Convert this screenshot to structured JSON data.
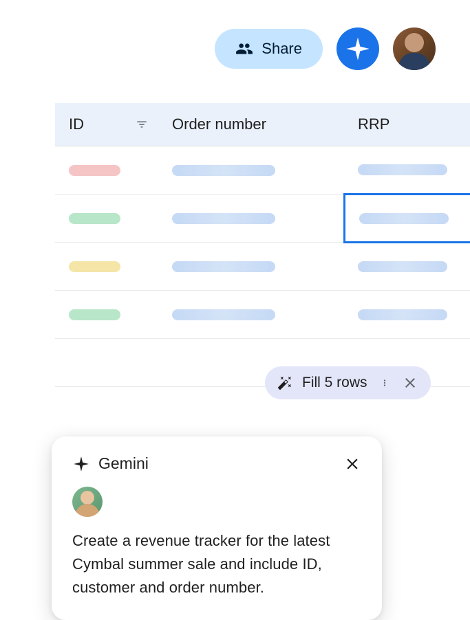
{
  "toolbar": {
    "share_label": "Share"
  },
  "table": {
    "columns": [
      "ID",
      "Order number",
      "RRP"
    ],
    "rows": [
      {
        "id_color": "red"
      },
      {
        "id_color": "green",
        "rrp_selected": true
      },
      {
        "id_color": "yellow"
      },
      {
        "id_color": "green"
      }
    ]
  },
  "fill_chip": {
    "label": "Fill 5 rows"
  },
  "gemini_panel": {
    "title": "Gemini",
    "prompt": "Create a revenue tracker for the latest Cymbal summer sale and include ID, customer and order number."
  }
}
